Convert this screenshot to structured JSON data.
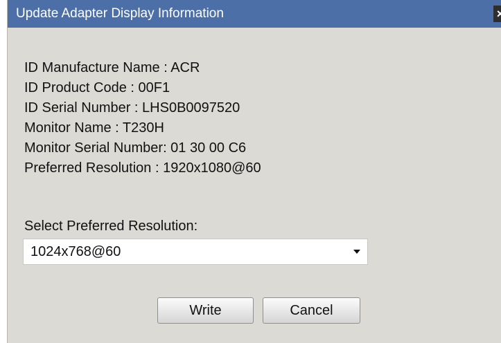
{
  "window": {
    "title": "Update Adapter Display Information",
    "close_label": "×"
  },
  "info": {
    "lines": [
      "ID Manufacture Name : ACR",
      "ID Product Code : 00F1",
      "ID Serial Number : LHS0B0097520",
      "Monitor Name : T230H",
      "Monitor Serial Number: 01 30 00 C6",
      "Preferred Resolution : 1920x1080@60"
    ]
  },
  "resolution": {
    "label": "Select Preferred Resolution:",
    "selected": "1024x768@60"
  },
  "buttons": {
    "write": "Write",
    "cancel": "Cancel"
  }
}
